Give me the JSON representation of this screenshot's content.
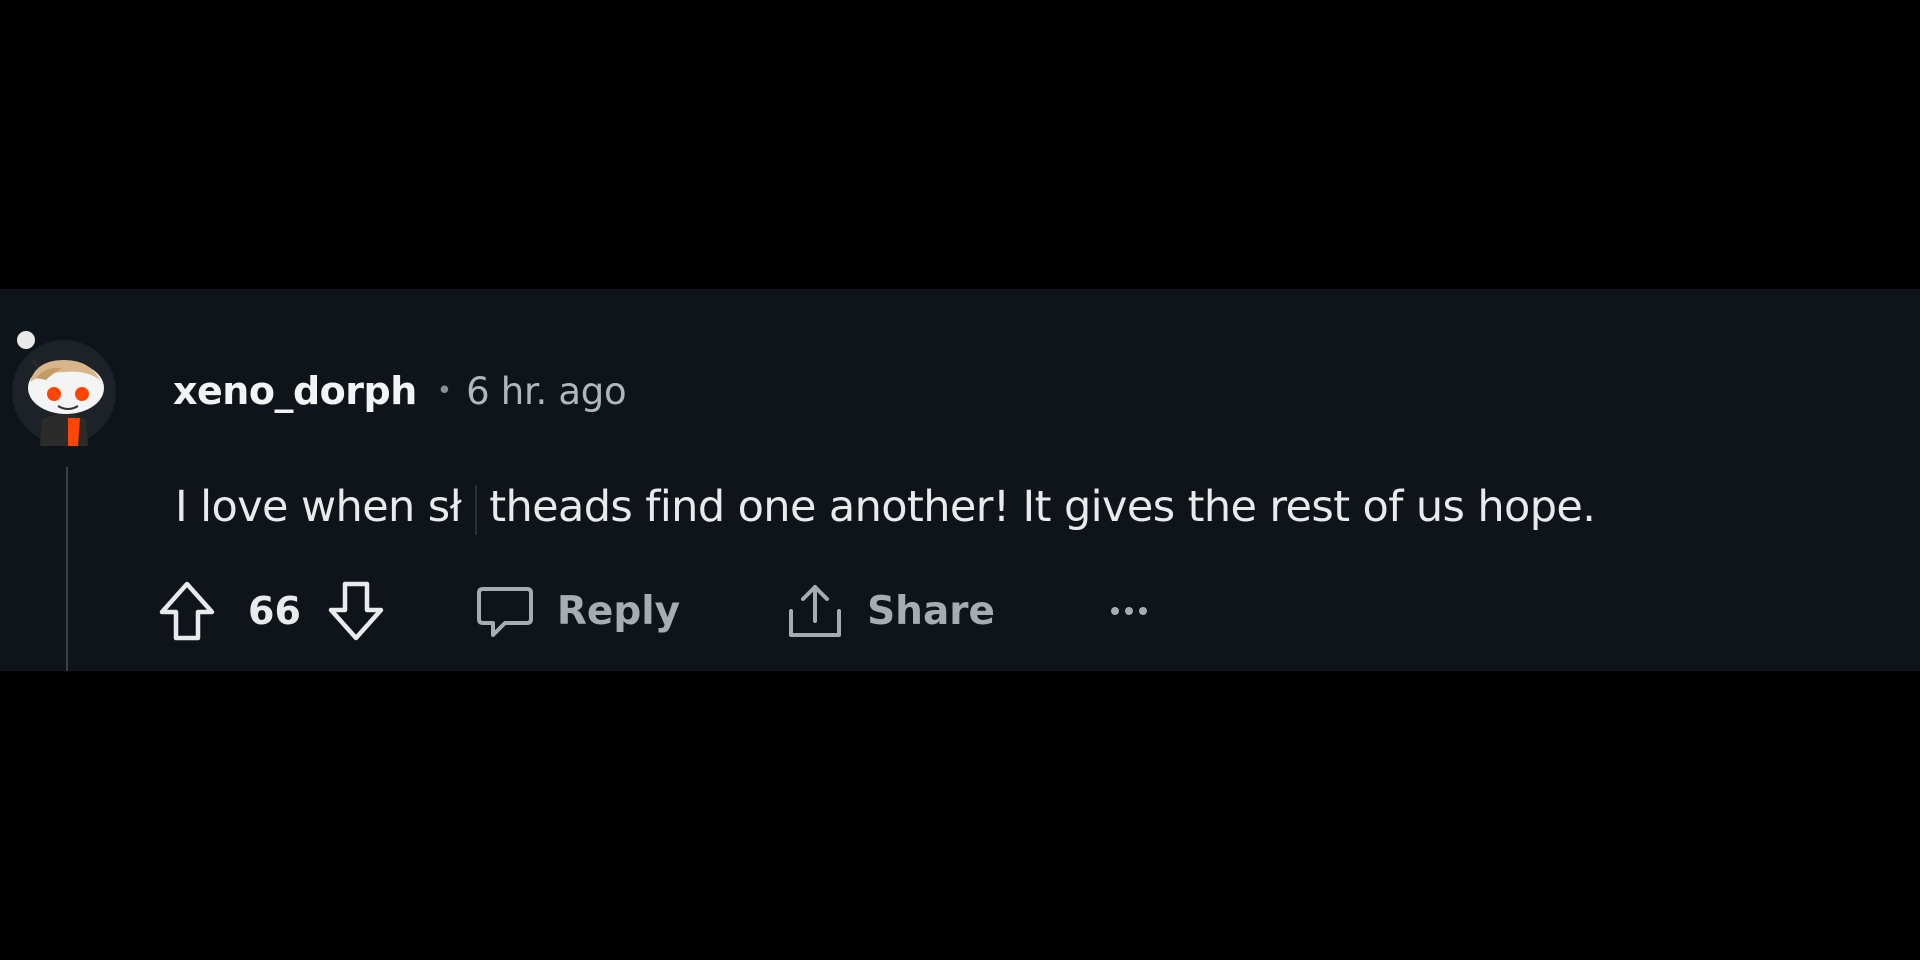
{
  "comment": {
    "username": "xeno_dorph",
    "separator": "•",
    "timestamp": "6 hr. ago",
    "text_before_cursor": "I love when sł",
    "text_after_cursor": "theads find one another! It gives the rest of us hope."
  },
  "actions": {
    "score": "66",
    "reply_label": "Reply",
    "share_label": "Share",
    "more_label": "•••"
  },
  "icons": {
    "upvote": "arrow-up-outline-icon",
    "downvote": "arrow-down-outline-icon",
    "reply": "comment-bubble-icon",
    "share": "share-upload-icon",
    "more": "ellipsis-icon",
    "avatar": "snoo-avatar"
  },
  "colors": {
    "page_background": "#000000",
    "card_background": "#0e1419",
    "username": "#f2f4f5",
    "body_text": "#e8eaec",
    "muted": "#a6adb2",
    "avatar_accent": "#ff4500"
  }
}
